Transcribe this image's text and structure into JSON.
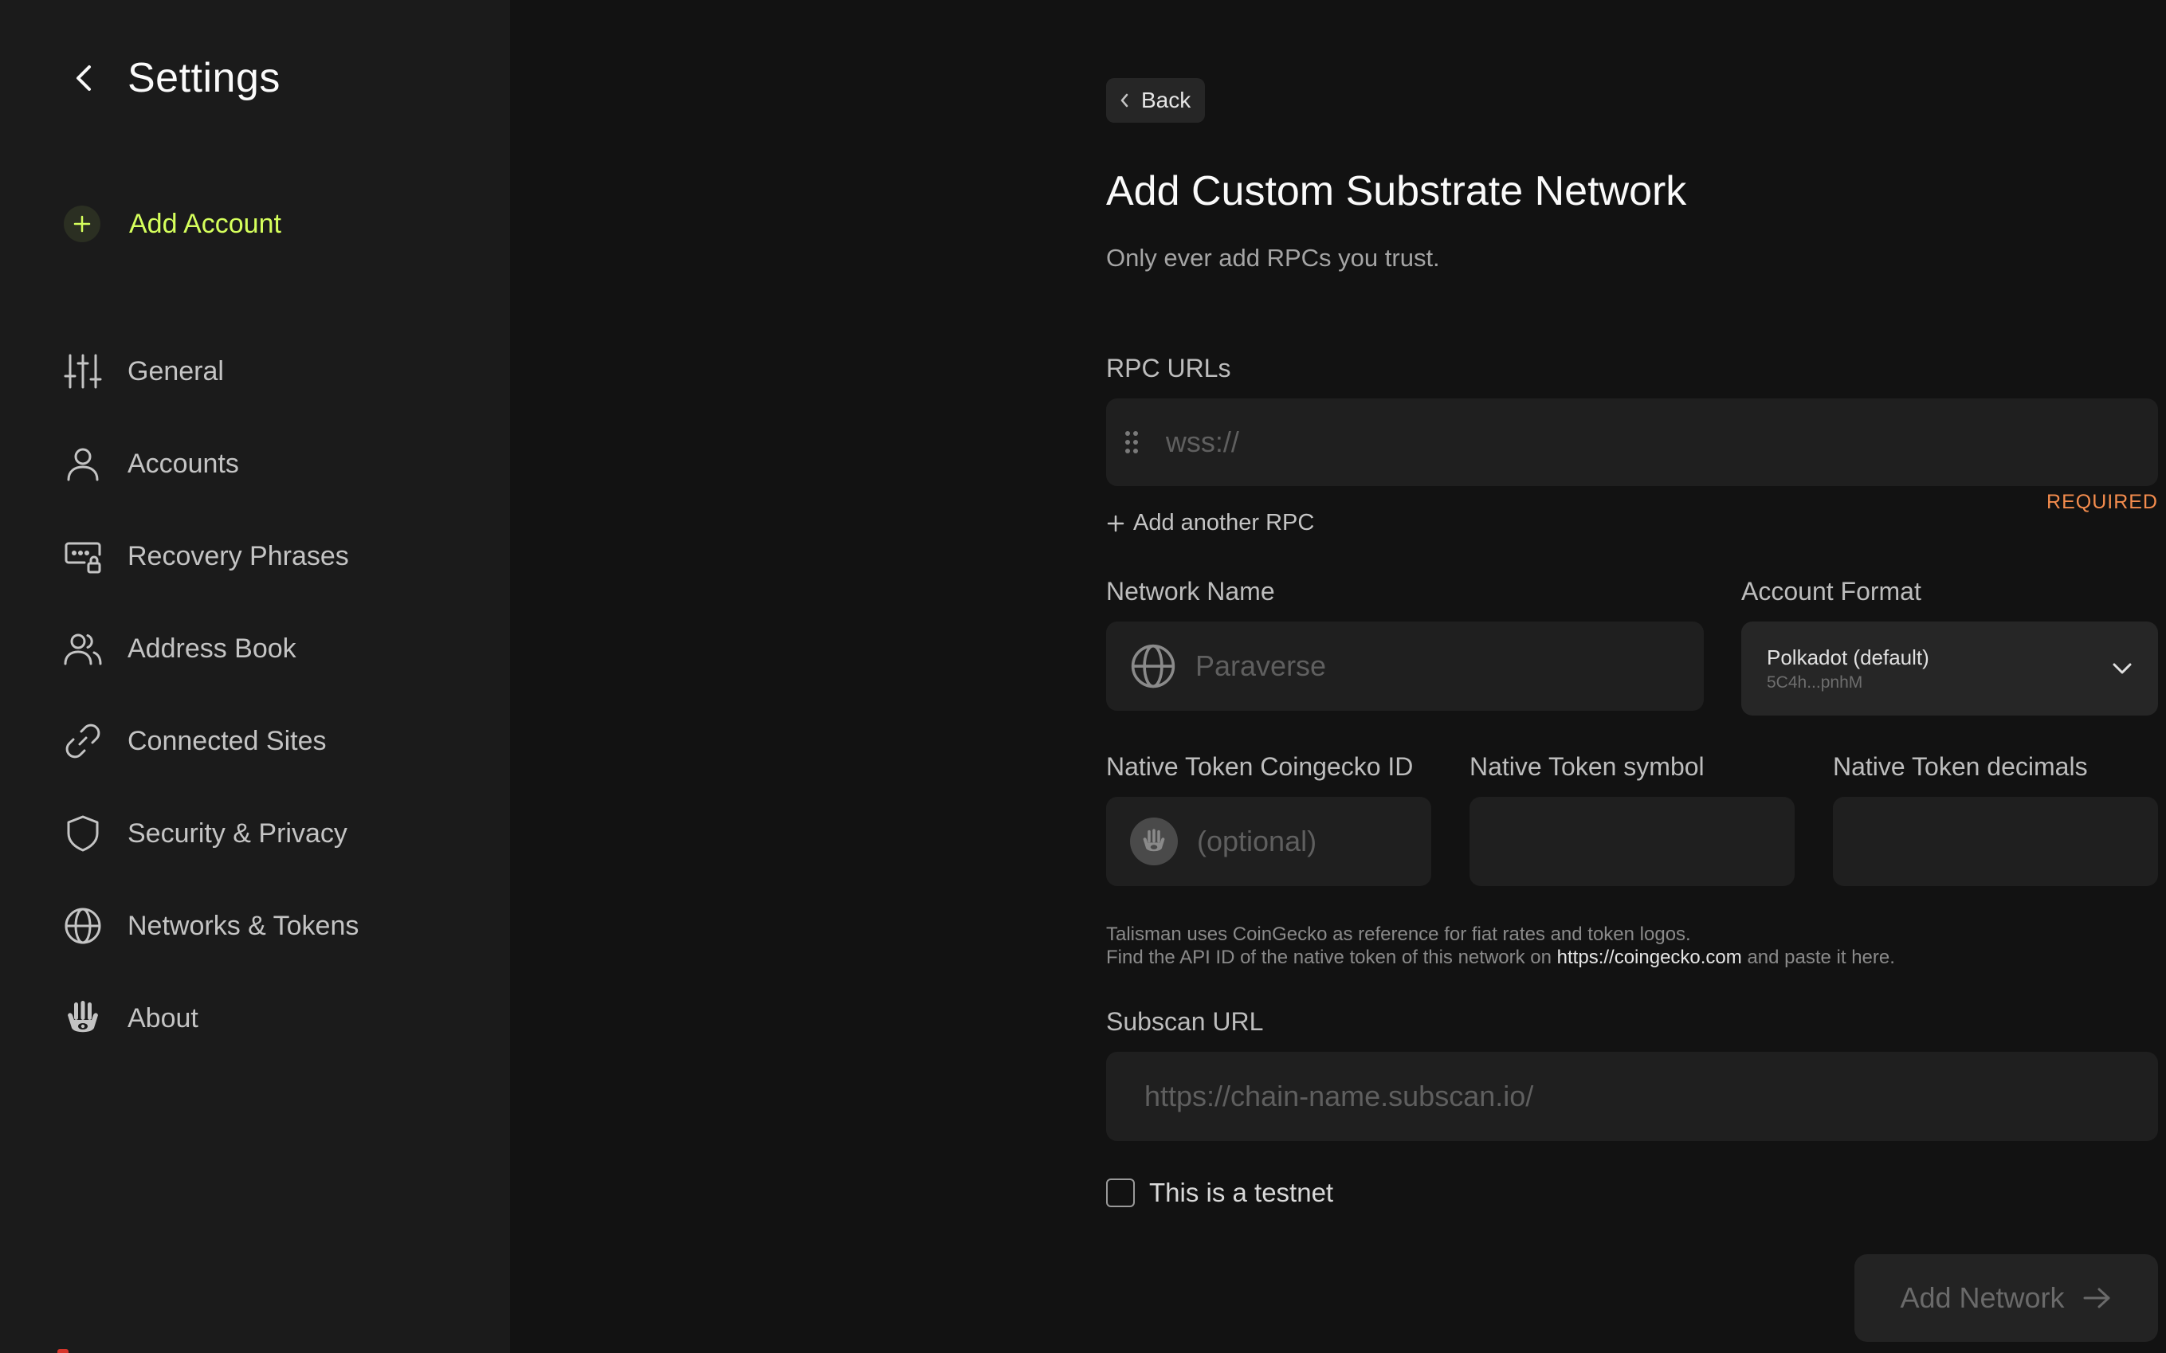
{
  "sidebar": {
    "title": "Settings",
    "add_account_label": "Add Account",
    "items": [
      {
        "label": "General",
        "icon": "sliders-icon"
      },
      {
        "label": "Accounts",
        "icon": "user-icon"
      },
      {
        "label": "Recovery Phrases",
        "icon": "keys-lock-icon"
      },
      {
        "label": "Address Book",
        "icon": "users-icon"
      },
      {
        "label": "Connected Sites",
        "icon": "link-icon"
      },
      {
        "label": "Security & Privacy",
        "icon": "shield-icon"
      },
      {
        "label": "Networks & Tokens",
        "icon": "globe-icon"
      },
      {
        "label": "About",
        "icon": "talisman-hand-icon"
      }
    ]
  },
  "main": {
    "back_label": "Back",
    "title": "Add Custom Substrate Network",
    "subtitle": "Only ever add RPCs you trust.",
    "rpc": {
      "label": "RPC URLs",
      "placeholder": "wss://",
      "required_text": "REQUIRED",
      "add_another_label": "Add another RPC"
    },
    "network_name": {
      "label": "Network Name",
      "placeholder": "Paraverse"
    },
    "account_format": {
      "label": "Account Format",
      "selected": "Polkadot (default)",
      "selected_sub": "5C4h...pnhM"
    },
    "coingecko": {
      "label": "Native Token Coingecko ID",
      "placeholder": "(optional)"
    },
    "symbol": {
      "label": "Native Token symbol",
      "placeholder": ""
    },
    "decimals": {
      "label": "Native Token decimals",
      "placeholder": ""
    },
    "help": {
      "line1": "Talisman uses CoinGecko as reference for fiat rates and token logos.",
      "line2_prefix": "Find the API ID of the native token of this network on ",
      "link": "https://coingecko.com",
      "line2_suffix": " and paste it here."
    },
    "subscan": {
      "label": "Subscan URL",
      "placeholder": "https://chain-name.subscan.io/"
    },
    "testnet_label": "This is a testnet",
    "submit_label": "Add Network"
  },
  "colors": {
    "background": "#121212",
    "sidebar": "#1b1b1b",
    "accent": "#d5ff5c",
    "required": "#f48c4d"
  }
}
